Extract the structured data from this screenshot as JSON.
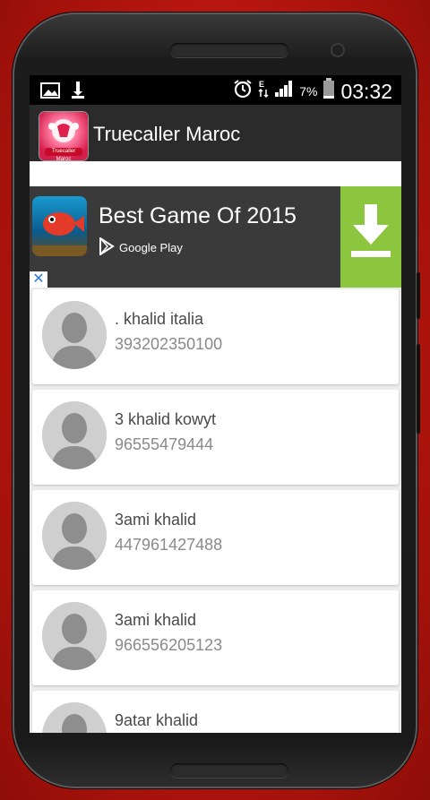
{
  "status_bar": {
    "time": "03:32",
    "battery_percent": "7%",
    "icons": [
      "image-icon",
      "download-icon",
      "alarm-icon",
      "data-icon",
      "signal-icon",
      "battery-icon"
    ]
  },
  "app": {
    "title": "Truecaller Maroc",
    "icon_label": "Truecaller Maroc"
  },
  "ad": {
    "title": "Best Game Of 2015",
    "store": "Google Play",
    "close_glyph": "✕",
    "accent_color": "#8cc63e"
  },
  "contacts": [
    {
      "name": ". khalid italia",
      "number": "393202350100"
    },
    {
      "name": "3 khalid kowyt",
      "number": "96555479444"
    },
    {
      "name": "3ami khalid",
      "number": "447961427488"
    },
    {
      "name": "3ami khalid",
      "number": "966556205123"
    },
    {
      "name": "9atar khalid",
      "number": ""
    }
  ]
}
